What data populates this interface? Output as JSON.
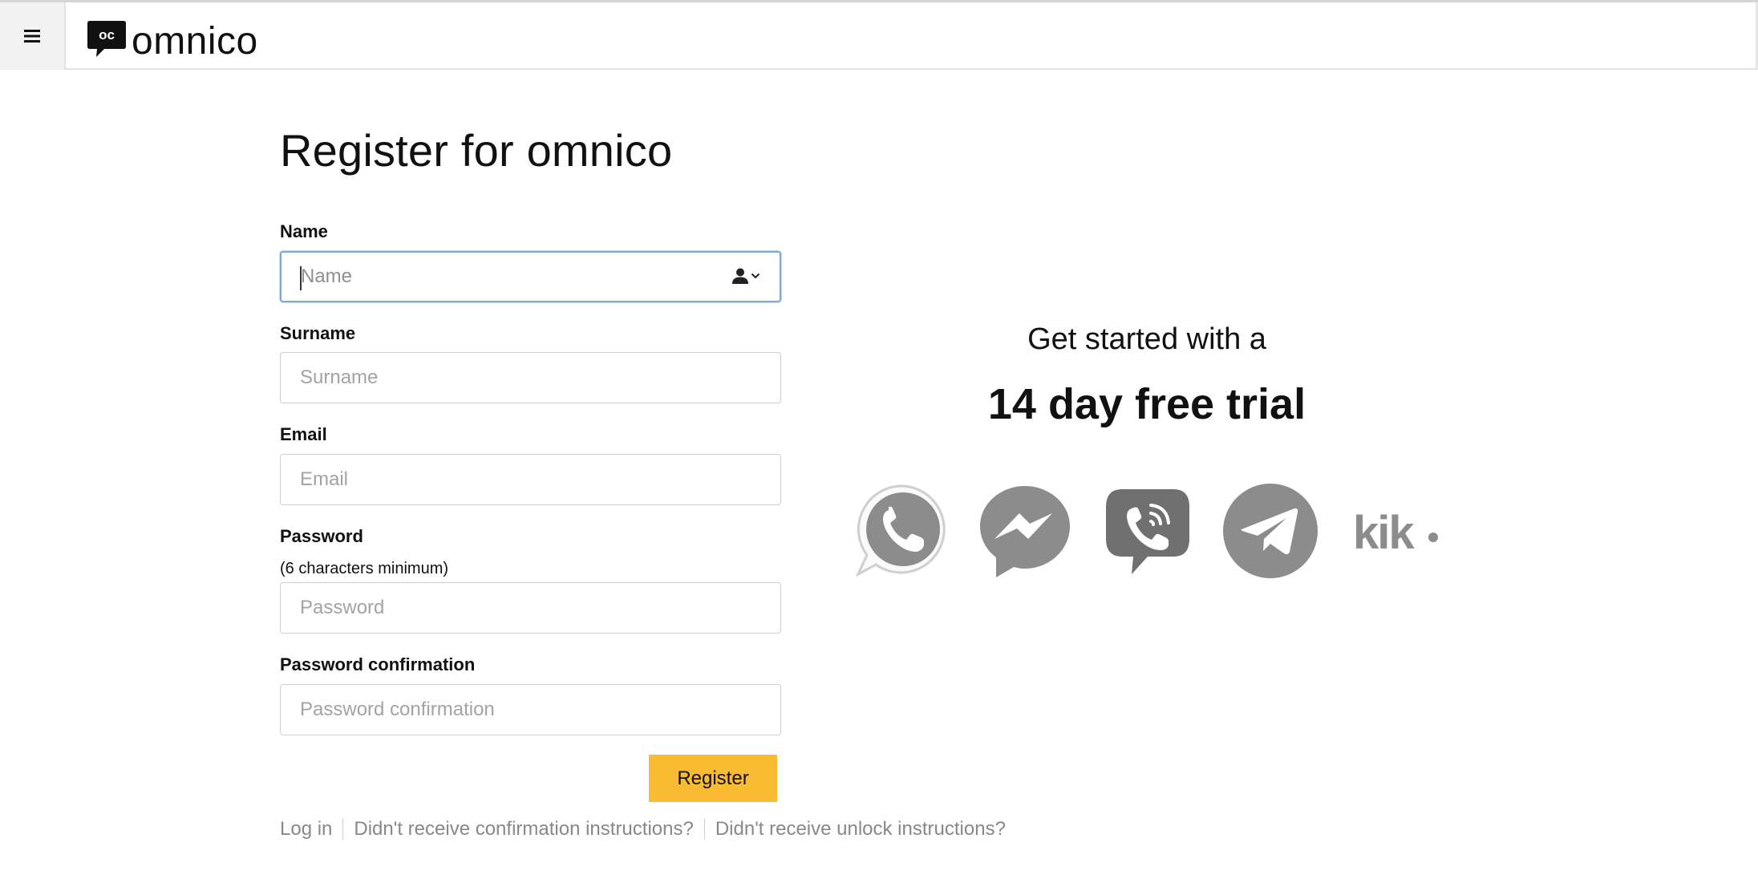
{
  "header": {
    "menu_icon": "hamburger-menu-icon",
    "logo_mark_text": "oc",
    "logo_text": "omnico"
  },
  "form": {
    "title": "Register for omnico",
    "fields": {
      "name": {
        "label": "Name",
        "placeholder": "Name",
        "value": "",
        "icon": "contact-card-icon"
      },
      "surname": {
        "label": "Surname",
        "placeholder": "Surname",
        "value": ""
      },
      "email": {
        "label": "Email",
        "placeholder": "Email",
        "value": ""
      },
      "password": {
        "label": "Password",
        "hint": "(6 characters minimum)",
        "placeholder": "Password",
        "value": ""
      },
      "password_confirmation": {
        "label": "Password confirmation",
        "placeholder": "Password confirmation",
        "value": ""
      }
    },
    "submit_label": "Register",
    "links": [
      "Log in",
      "Didn't receive confirmation instructions?",
      "Didn't receive unlock instructions?"
    ]
  },
  "promo": {
    "line1": "Get started with a",
    "line2": "14 day free trial",
    "apps": [
      "whatsapp",
      "messenger",
      "viber",
      "telegram",
      "kik"
    ],
    "kik_text": "kik"
  },
  "colors": {
    "accent": "#f8bb31",
    "focus_border": "#7fa6d6",
    "icon_gray": "#8a8a8a"
  }
}
